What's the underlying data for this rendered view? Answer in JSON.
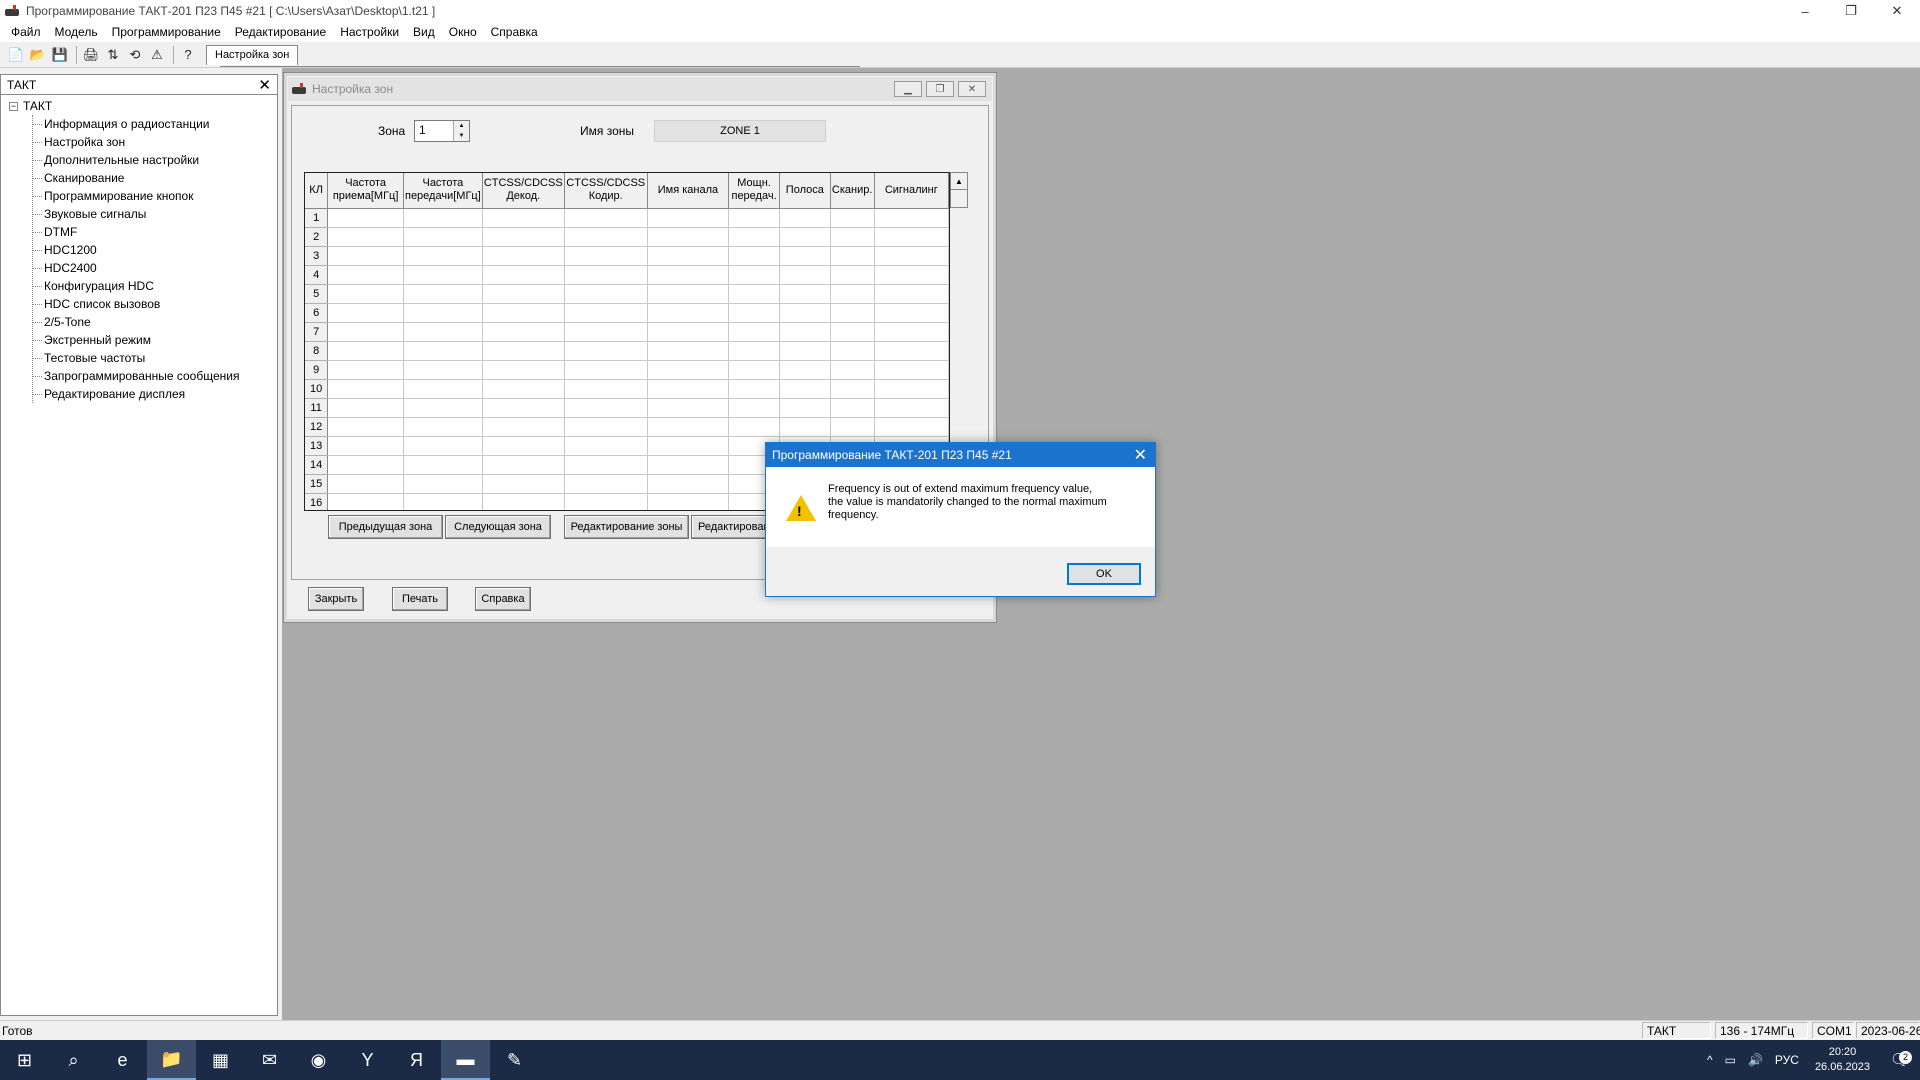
{
  "app": {
    "title": "Программирование ТАКТ-201 П23 П45 #21 [ C:\\Users\\Азат\\Desktop\\1.t21 ]",
    "win_ctrls": [
      "–",
      "❐",
      "✕"
    ]
  },
  "menu": [
    "Файл",
    "Модель",
    "Программирование",
    "Редактирование",
    "Настройки",
    "Вид",
    "Окно",
    "Справка"
  ],
  "toolbar": {
    "icons": [
      "📄",
      "📂",
      "💾",
      "🖨",
      "⇅",
      "⟲",
      "⚠",
      "?"
    ],
    "tab_label": "Настройка зон"
  },
  "tree": {
    "header": "ТАКТ",
    "close": "✕",
    "root": "ТАКТ",
    "root_toggle": "−",
    "items": [
      "Информация о радиостанции",
      "Настройка зон",
      "Дополнительные настройки",
      "Сканирование",
      "Программирование кнопок",
      "Звуковые сигналы",
      "DTMF",
      "HDC1200",
      "HDC2400",
      "Конфигурация HDC",
      "HDC список вызовов",
      "2/5-Tone",
      "Экстренный режим",
      "Тестовые частоты",
      "Запрограммированные сообщения",
      "Редактирование дисплея"
    ]
  },
  "child": {
    "title": "Настройка зон",
    "ctrls": [
      "▁",
      "❐",
      "✕"
    ],
    "zone_label": "Зона",
    "zone_value": "1",
    "zone_name_label": "Имя зоны",
    "zone_name_value": "ZONE 1",
    "columns": [
      "КЛ",
      "Частота приема[МГц]",
      "Частота передачи[МГц]",
      "CTCSS/CDCSS Декод.",
      "CTCSS/CDCSS Кодир.",
      "Имя канала",
      "Мощн. передач.",
      "Полоса",
      "Сканир.",
      "Сигналинг"
    ],
    "rows": [
      "1",
      "2",
      "3",
      "4",
      "5",
      "6",
      "7",
      "8",
      "9",
      "10",
      "11",
      "12",
      "13",
      "14",
      "15",
      "16"
    ],
    "buttons": {
      "prev_zone": "Предыдущая зона",
      "next_zone": "Следующая зона",
      "edit_zone": "Редактирование зоны",
      "edit_more": "Редактирован"
    },
    "bottom": {
      "close": "Закрыть",
      "print": "Печать",
      "help": "Справка"
    }
  },
  "dialog": {
    "title": "Программирование ТАКТ-201 П23 П45 #21",
    "close": "✕",
    "message_lines": [
      "Frequency is out of extend maximum frequency value,",
      "the value is mandatorily changed to the normal maximum",
      "frequency."
    ],
    "ok": "OK",
    "accent": "#1c73cd"
  },
  "status": {
    "ready": "Готов",
    "model": "ТАКТ",
    "range": "136 - 174МГц",
    "port": "COM1",
    "date": "2023-06-26"
  },
  "taskbar": {
    "icons": [
      "⊞",
      "⌕",
      "e",
      "📁",
      "▦",
      "✉",
      "◉",
      "Y",
      "Я",
      "▬",
      "✎"
    ],
    "tray": [
      "^",
      "▭",
      "🔊"
    ],
    "lang": "РУС",
    "time": "20:20",
    "date": "26.06.2023",
    "notif_icon": "🗨",
    "notif_count": "2"
  }
}
